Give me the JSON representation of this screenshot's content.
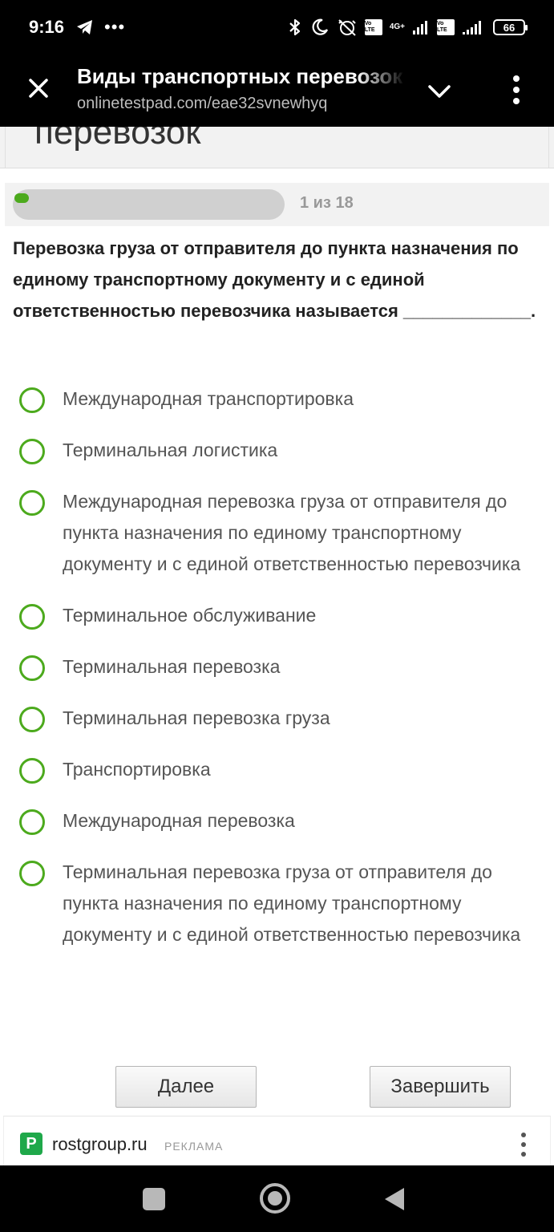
{
  "status_bar": {
    "time": "9:16",
    "dots": "•••",
    "volte1": "Vo LTE",
    "net": "4G+",
    "volte2": "Vo LTE",
    "battery": "66"
  },
  "browser": {
    "title": "Виды транспортных перевозок",
    "url": "onlinetestpad.com/eae32svnewhyq"
  },
  "page": {
    "heading": "перевозок"
  },
  "progress": {
    "label": "1 из 18",
    "current": 1,
    "total": 18,
    "fill_color": "#4caa1d"
  },
  "question": {
    "text": "Перевозка груза от отправителя до пункта назначения по единому транспортному документу и с единой ответственностью перевозчика называется _____________."
  },
  "options": [
    "Международная транспортировка",
    "Терминальная логистика",
    "Международная перевозка груза от отправителя до пункта назначения по единому транспортному документу и с единой ответственностью перевозчика",
    "Терминальное обслуживание",
    "Терминальная перевозка",
    "Терминальная перевозка груза",
    "Транспортировка",
    "Международная перевозка",
    "Терминальная перевозка груза от отправителя до пункта назначения по единому транспортному документу и с единой ответственностью перевозчика"
  ],
  "buttons": {
    "next": "Далее",
    "finish": "Завершить"
  },
  "ad": {
    "logo_letter": "P",
    "domain": "rostgroup.ru",
    "label": "РЕКЛАМА"
  },
  "colors": {
    "accent": "#4caa1d",
    "ad_logo": "#1fa84a"
  }
}
